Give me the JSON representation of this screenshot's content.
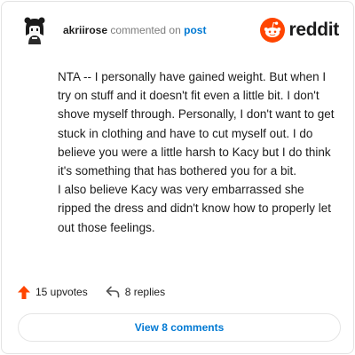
{
  "comment": {
    "username": "akriirose",
    "action_text": "commented on",
    "post_link_text": "post",
    "paragraphs": [
      "NTA -- I personally have gained weight. But when I try on stuff and it doesn't fit even a little bit. I don't shove myself through. Personally, I don't want to get stuck in clothing and have to cut myself out. I do believe you were a little harsh to Kacy but I do think it's something that has bothered you for a bit.",
      "I also believe Kacy was very embarrassed she ripped the dress and didn't know how to properly let out those feelings."
    ]
  },
  "brand": {
    "name": "reddit",
    "icon": "reddit-logo-icon",
    "color": "#ff4500"
  },
  "stats": {
    "upvotes_label": "15 upvotes",
    "replies_label": "8 replies",
    "upvote_icon": "upvote-arrow-icon",
    "reply_icon": "reply-arrow-icon",
    "upvote_color": "#ff4500"
  },
  "actions": {
    "view_comments_label": "View 8 comments"
  }
}
